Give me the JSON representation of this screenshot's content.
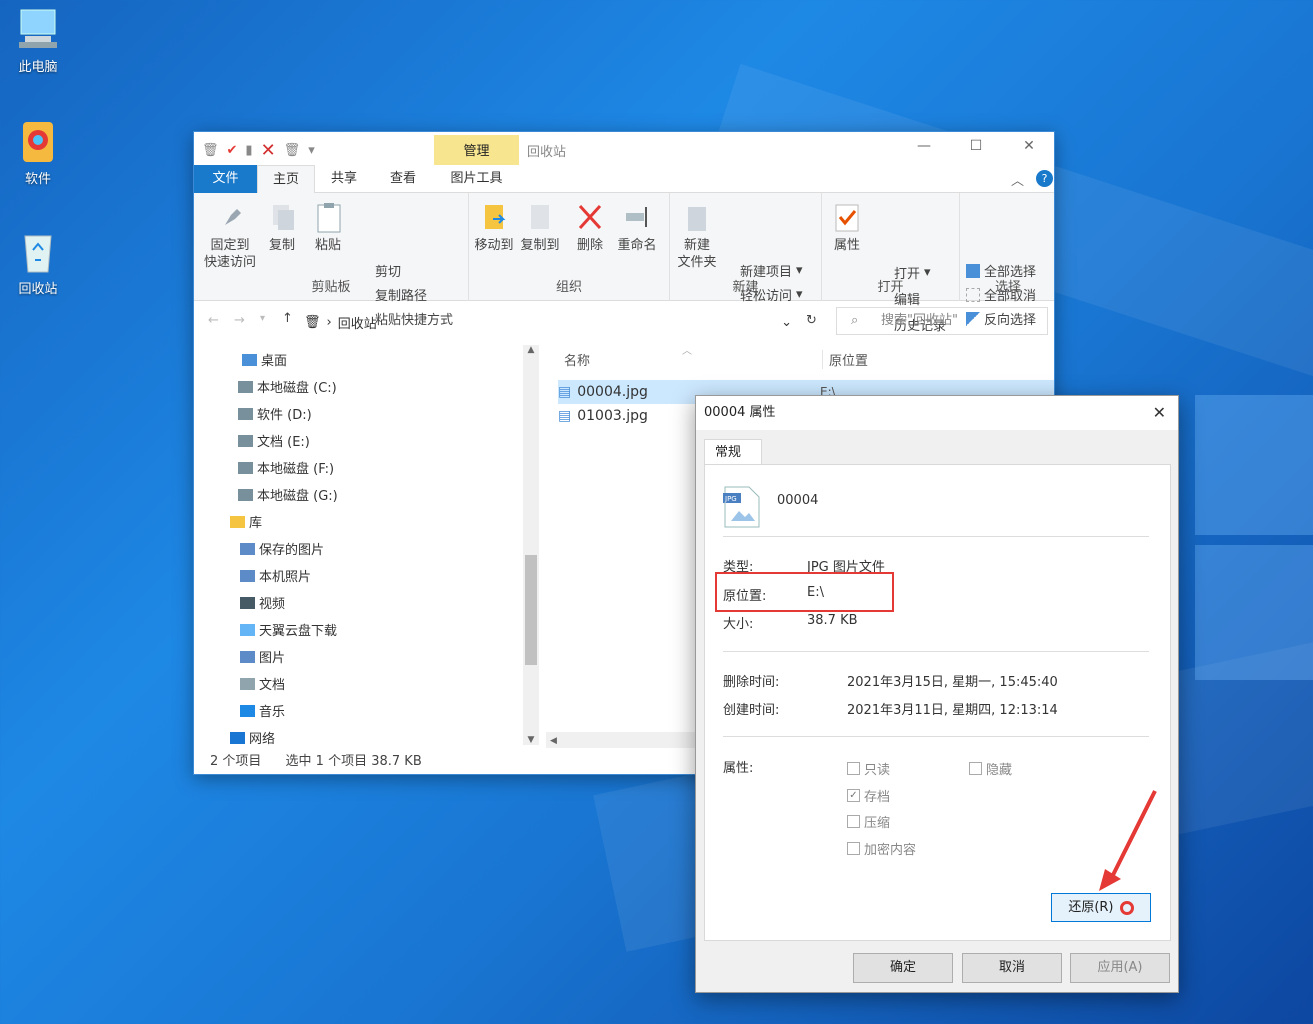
{
  "desktop": {
    "icons": [
      {
        "label": "此电脑",
        "icon": "computer-icon"
      },
      {
        "label": "软件",
        "icon": "folder-icon"
      },
      {
        "label": "回收站",
        "icon": "recycle-bin-icon"
      }
    ]
  },
  "explorer": {
    "context_tab": "管理",
    "title": "回收站",
    "tabs": [
      "文件",
      "主页",
      "共享",
      "查看",
      "图片工具"
    ],
    "ribbon": {
      "clipboard": {
        "pin": "固定到\n快速访问",
        "copy": "复制",
        "paste": "粘贴",
        "cut": "剪切",
        "copy_path": "复制路径",
        "paste_shortcut": "粘贴快捷方式",
        "label": "剪贴板"
      },
      "organize": {
        "move_to": "移动到",
        "copy_to": "复制到",
        "delete": "删除",
        "rename": "重命名",
        "label": "组织"
      },
      "new": {
        "new_folder": "新建\n文件夹",
        "new_item": "新建项目",
        "easy_access": "轻松访问",
        "label": "新建"
      },
      "open": {
        "properties": "属性",
        "open": "打开",
        "edit": "编辑",
        "history": "历史记录",
        "label": "打开"
      },
      "select": {
        "select_all": "全部选择",
        "select_none": "全部取消",
        "invert": "反向选择",
        "label": "选择"
      }
    },
    "address": {
      "path": "回收站",
      "search_placeholder": "搜索\"回收站\""
    },
    "nav": [
      {
        "label": "桌面",
        "icon": "desktop-folder-icon"
      },
      {
        "label": "本地磁盘 (C:)",
        "icon": "drive-icon"
      },
      {
        "label": "软件 (D:)",
        "icon": "drive-icon"
      },
      {
        "label": "文档 (E:)",
        "icon": "drive-icon"
      },
      {
        "label": "本地磁盘 (F:)",
        "icon": "drive-icon"
      },
      {
        "label": "本地磁盘 (G:)",
        "icon": "drive-icon"
      },
      {
        "label": "库",
        "icon": "library-icon"
      },
      {
        "label": "保存的图片",
        "icon": "pictures-icon"
      },
      {
        "label": "本机照片",
        "icon": "pictures-icon"
      },
      {
        "label": "视频",
        "icon": "video-icon"
      },
      {
        "label": "天翼云盘下载",
        "icon": "cloud-icon"
      },
      {
        "label": "图片",
        "icon": "pictures-icon"
      },
      {
        "label": "文档",
        "icon": "documents-icon"
      },
      {
        "label": "音乐",
        "icon": "music-icon"
      },
      {
        "label": "网络",
        "icon": "network-icon"
      }
    ],
    "columns": {
      "name": "名称",
      "location": "原位置"
    },
    "files": [
      {
        "name": "00004.jpg",
        "location": "E:\\"
      },
      {
        "name": "01003.jpg",
        "location": ""
      }
    ],
    "status": {
      "count": "2 个项目",
      "selection": "选中 1 个项目  38.7 KB"
    }
  },
  "dialog": {
    "title": "00004 属性",
    "tab": "常规",
    "filename": "00004",
    "type_label": "类型:",
    "type_value": "JPG 图片文件",
    "location_label": "原位置:",
    "location_value": "E:\\",
    "size_label": "大小:",
    "size_value": "38.7 KB",
    "deleted_label": "删除时间:",
    "deleted_value": "2021年3月15日, 星期一, 15:45:40",
    "created_label": "创建时间:",
    "created_value": "2021年3月11日, 星期四, 12:13:14",
    "attributes_label": "属性:",
    "attributes": {
      "readonly": "只读",
      "hidden": "隐藏",
      "archive": "存档",
      "compress": "压缩",
      "encrypt": "加密内容"
    },
    "restore": "还原(R)",
    "ok": "确定",
    "cancel": "取消",
    "apply": "应用(A)"
  },
  "colors": {
    "accent": "#0078d7",
    "highlight": "#e53935",
    "context_tab": "#f7e58f"
  }
}
